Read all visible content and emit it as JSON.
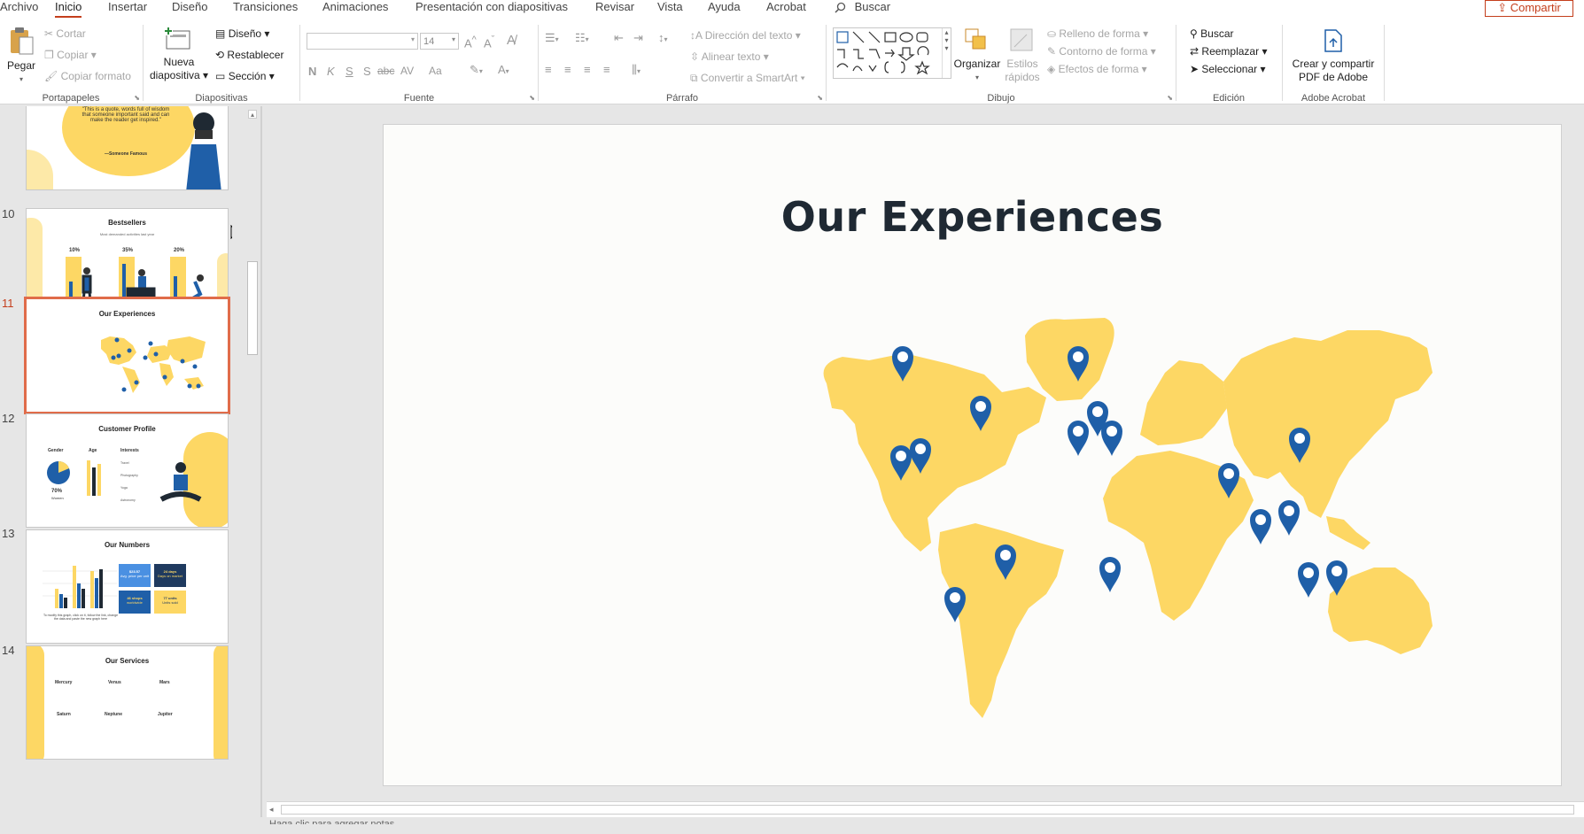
{
  "menu_tabs": [
    "Archivo",
    "Inicio",
    "Insertar",
    "Diseño",
    "Transiciones",
    "Animaciones",
    "Presentación con diapositivas",
    "Revisar",
    "Vista",
    "Ayuda",
    "Acrobat"
  ],
  "search": {
    "label": "Buscar",
    "icon": "search-icon"
  },
  "share": {
    "label": "Compartir",
    "icon": "share-icon"
  },
  "ribbon": {
    "portapapeles": {
      "label": "Portapapeles",
      "pegar": "Pegar",
      "cortar": "Cortar",
      "copiar": "Copiar",
      "copiar_formato": "Copiar formato"
    },
    "diapositivas": {
      "label": "Diapositivas",
      "nueva1": "Nueva",
      "nueva2": "diapositiva",
      "diseno": "Diseño",
      "restablecer": "Restablecer",
      "seccion": "Sección"
    },
    "fuente": {
      "label": "Fuente",
      "size": "14",
      "n": "N",
      "k": "K",
      "s": "S",
      "s2": "S",
      "abc": "abc",
      "av": "AV",
      "aa": "Aa"
    },
    "parrafo": {
      "label": "Párrafo",
      "direccion": "Dirección del texto",
      "alinear": "Alinear texto",
      "smartart": "Convertir a SmartArt"
    },
    "dibujo": {
      "label": "Dibujo",
      "organizar": "Organizar",
      "estilos1": "Estilos",
      "estilos2": "rápidos",
      "relleno": "Relleno de forma",
      "contorno": "Contorno de forma",
      "efectos": "Efectos de forma"
    },
    "edicion": {
      "label": "Edición",
      "buscar": "Buscar",
      "reemplazar": "Reemplazar",
      "seleccionar": "Seleccionar"
    },
    "acrobat": {
      "label": "Adobe Acrobat",
      "crear1": "Crear y compartir",
      "crear2": "PDF de Adobe"
    }
  },
  "thumbnails": [
    {
      "num": "",
      "title": "",
      "quote": "\"This is a quote, words full of wisdom that someone important said and can make the reader get inspired.\"",
      "author": "—Someone Famous"
    },
    {
      "num": "10",
      "title": "Bestsellers",
      "subtitle": "Most demanded activities last year",
      "values": [
        "10%",
        "35%",
        "20%"
      ]
    },
    {
      "num": "11",
      "title": "Our Experiences"
    },
    {
      "num": "12",
      "title": "Customer Profile",
      "labels": [
        "Gender",
        "Age",
        "Interests"
      ],
      "stat": "70%",
      "stat_label": "Women",
      "interests": [
        "Travel",
        "Photography",
        "Yoga",
        "Astronomy"
      ]
    },
    {
      "num": "13",
      "title": "Our Numbers",
      "boxes": [
        {
          "value": "$23.57",
          "label": "Avg. price per unit"
        },
        {
          "value": "24 days",
          "label": "Days on market"
        },
        {
          "value": "46 shops",
          "label": "worldwide"
        },
        {
          "value": "77 units",
          "label": "Units sold"
        }
      ],
      "caption": "To modify this graph, click on it, follow the link, change the data and paste the new graph here"
    },
    {
      "num": "14",
      "title": "Our Services",
      "items": [
        "Mercury",
        "Venus",
        "Mars",
        "Saturn",
        "Neptune",
        "Jupiter"
      ]
    }
  ],
  "slide": {
    "title": "Our Experiences",
    "map_color": "#fdd764",
    "pin_color": "#1f5fa8"
  },
  "status": {
    "notes": "Haga clic para agregar notas"
  }
}
